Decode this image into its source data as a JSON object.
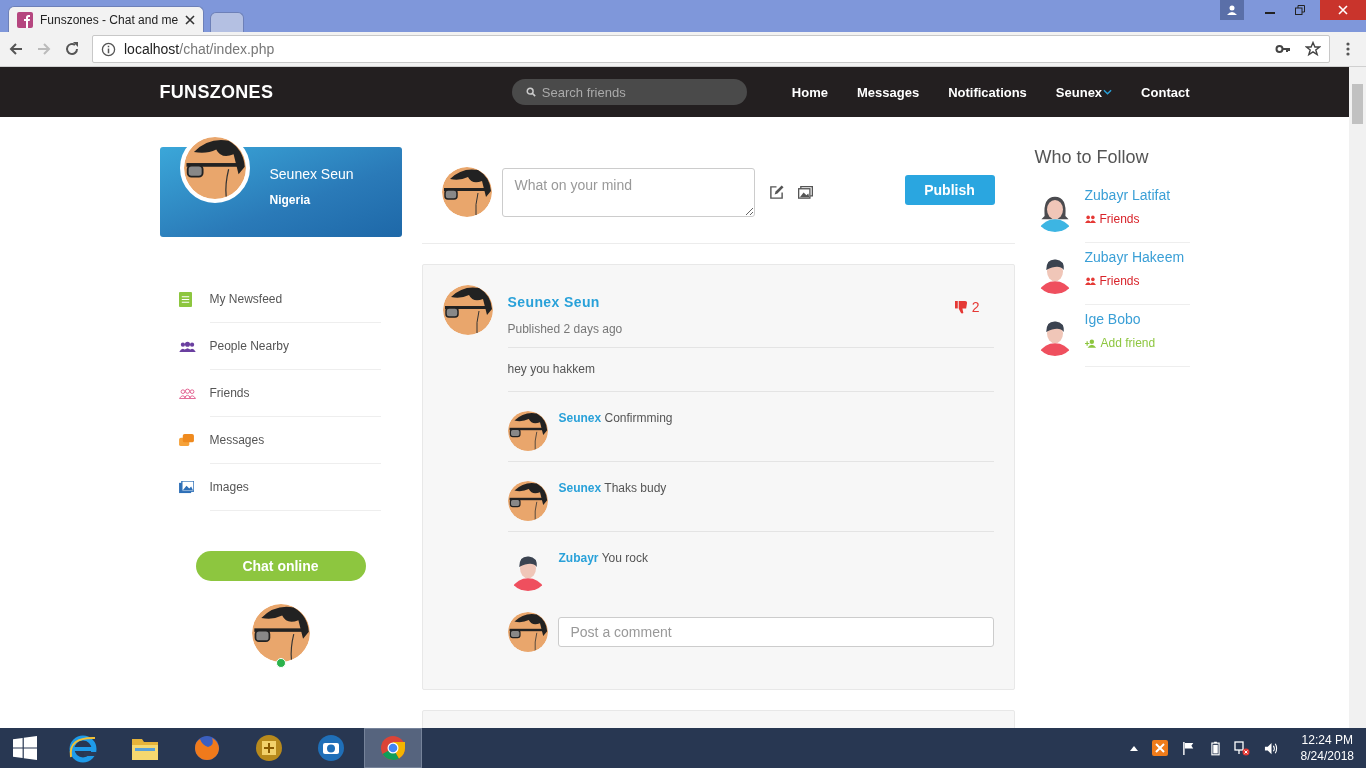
{
  "browser": {
    "tabs": [
      {
        "title": "Funszones - Chat and me",
        "selected": true
      },
      {
        "selected": false
      }
    ],
    "address": {
      "host": "localhost",
      "path": "/chat/index.php"
    }
  },
  "navbar": {
    "brand": "FUNSZONES",
    "search_placeholder": "Search friends",
    "links": [
      {
        "label": "Home",
        "kind": "link"
      },
      {
        "label": "Messages",
        "kind": "link"
      },
      {
        "label": "Notifications",
        "kind": "link"
      },
      {
        "label": "Seunex",
        "kind": "dropdown"
      },
      {
        "label": "Contact",
        "kind": "link"
      }
    ]
  },
  "profile": {
    "name": "Seunex Seun",
    "country": "Nigeria"
  },
  "menu": [
    {
      "label": "My Newsfeed",
      "kind": "newsfeed"
    },
    {
      "label": "People Nearby",
      "kind": "people"
    },
    {
      "label": "Friends",
      "kind": "friends"
    },
    {
      "label": "Messages",
      "kind": "messages"
    },
    {
      "label": "Images",
      "kind": "images"
    }
  ],
  "chat": {
    "button": "Chat online",
    "online": true
  },
  "composer": {
    "placeholder": "What on your mind",
    "button": "Publish"
  },
  "post": {
    "author": "Seunex Seun",
    "time": "Published 2 days ago",
    "dislikes": "2",
    "text": "hey you hakkem",
    "comments": [
      {
        "author": "Seunex",
        "text": "Confirmming",
        "avatar": {
          "kind": "glasses"
        }
      },
      {
        "author": "Seunex",
        "text": "Thaks budy",
        "avatar": {
          "kind": "glasses"
        }
      },
      {
        "author": "Zubayr",
        "text": "You rock",
        "avatar": {
          "kind": "man"
        }
      }
    ],
    "comment_placeholder": "Post a comment"
  },
  "who_to_follow": {
    "title": "Who to Follow",
    "people": [
      {
        "name": "Zubayr Latifat",
        "status": "Friends",
        "kind": "friends",
        "avatar": {
          "kind": "woman"
        }
      },
      {
        "name": "Zubayr Hakeem",
        "status": "Friends",
        "kind": "friends",
        "avatar": {
          "kind": "man"
        }
      },
      {
        "name": "Ige Bobo",
        "status": "Add friend",
        "kind": "add",
        "avatar": {
          "kind": "man"
        }
      }
    ]
  },
  "taskbar": {
    "apps": [
      {
        "kind": "ie",
        "selected": false
      },
      {
        "kind": "folder",
        "selected": false
      },
      {
        "kind": "firefox",
        "selected": false
      },
      {
        "kind": "tool",
        "selected": false
      },
      {
        "kind": "camera",
        "selected": false
      },
      {
        "kind": "chrome",
        "selected": true
      }
    ],
    "time": "12:24 PM",
    "date": "8/24/2018"
  }
}
